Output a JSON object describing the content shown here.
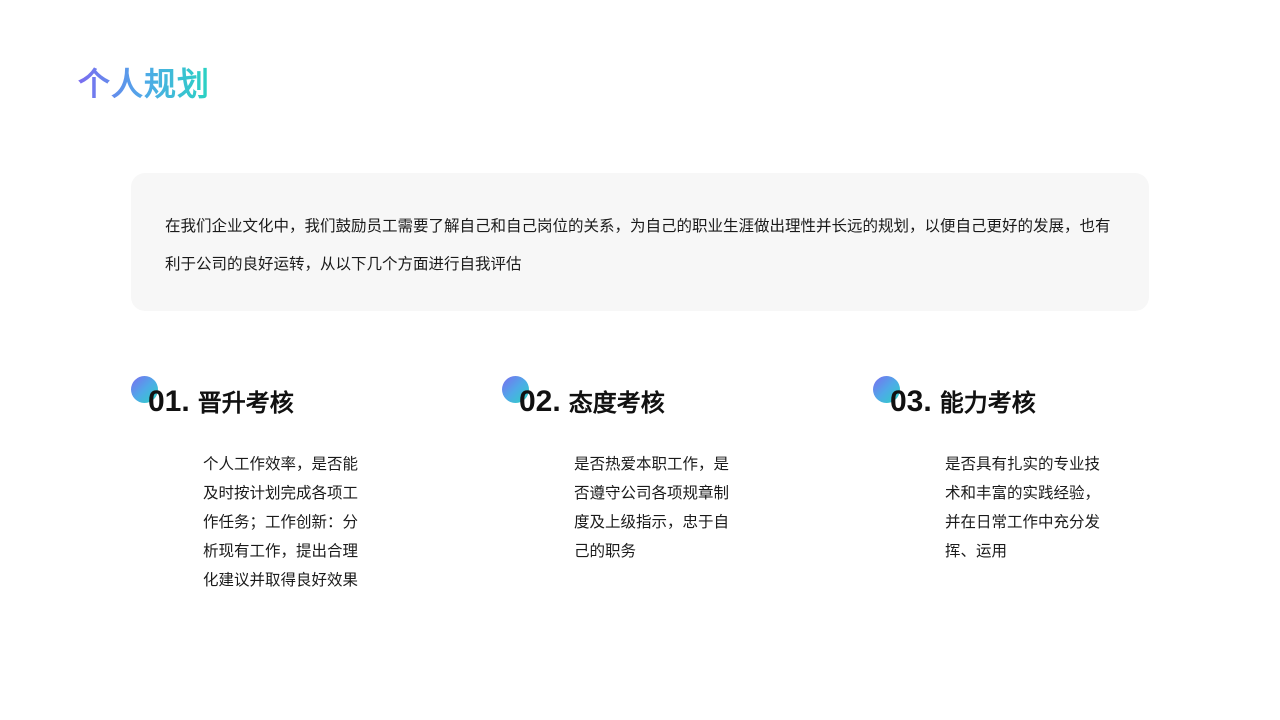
{
  "title": "个人规划",
  "intro": "在我们企业文化中，我们鼓励员工需要了解自己和自己岗位的关系，为自己的职业生涯做出理性并长远的规划，以便自己更好的发展，也有利于公司的良好运转，从以下几个方面进行自我评估",
  "cards": [
    {
      "number": "01.",
      "heading": "晋升考核",
      "text": "个人工作效率，是否能及时按计划完成各项工作任务；工作创新：分析现有工作，提出合理化建议并取得良好效果"
    },
    {
      "number": "02.",
      "heading": "态度考核",
      "text": "是否热爱本职工作，是否遵守公司各项规章制度及上级指示，忠于自己的职务"
    },
    {
      "number": "03.",
      "heading": "能力考核",
      "text": "是否具有扎实的专业技术和丰富的实践经验，并在日常工作中充分发挥、运用"
    }
  ],
  "colors": {
    "gradient_start": "#7b6cf0",
    "gradient_mid": "#4fa9e8",
    "gradient_end": "#2ad3c2",
    "panel_bg": "#f7f7f7",
    "text": "#1a1a1a"
  }
}
